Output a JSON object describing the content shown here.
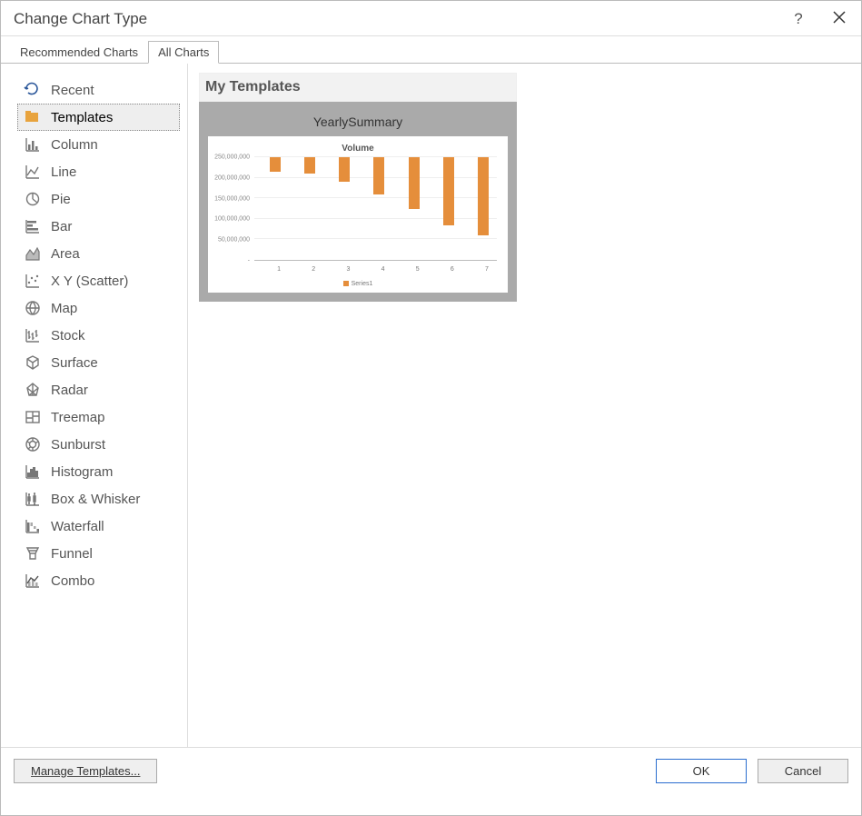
{
  "dialog": {
    "title": "Change Chart Type"
  },
  "tabs": {
    "recommended": "Recommended Charts",
    "all": "All Charts"
  },
  "sidebar": [
    {
      "label": "Recent",
      "icon": "recent"
    },
    {
      "label": "Templates",
      "icon": "templates"
    },
    {
      "label": "Column",
      "icon": "column"
    },
    {
      "label": "Line",
      "icon": "line"
    },
    {
      "label": "Pie",
      "icon": "pie"
    },
    {
      "label": "Bar",
      "icon": "bar"
    },
    {
      "label": "Area",
      "icon": "area"
    },
    {
      "label": "X Y (Scatter)",
      "icon": "scatter"
    },
    {
      "label": "Map",
      "icon": "map"
    },
    {
      "label": "Stock",
      "icon": "stock"
    },
    {
      "label": "Surface",
      "icon": "surface"
    },
    {
      "label": "Radar",
      "icon": "radar"
    },
    {
      "label": "Treemap",
      "icon": "treemap"
    },
    {
      "label": "Sunburst",
      "icon": "sunburst"
    },
    {
      "label": "Histogram",
      "icon": "histogram"
    },
    {
      "label": "Box & Whisker",
      "icon": "boxwhisker"
    },
    {
      "label": "Waterfall",
      "icon": "waterfall"
    },
    {
      "label": "Funnel",
      "icon": "funnel"
    },
    {
      "label": "Combo",
      "icon": "combo"
    }
  ],
  "activeSidebarIndex": 1,
  "section": {
    "title": "My Templates"
  },
  "template": {
    "name": "YearlySummary"
  },
  "chart_data": {
    "type": "bar",
    "title": "Volume",
    "categories": [
      "1",
      "2",
      "3",
      "4",
      "5",
      "6",
      "7"
    ],
    "values": [
      35000000,
      40000000,
      60000000,
      90000000,
      125000000,
      165000000,
      190000000
    ],
    "yticks": [
      "-",
      "50,000,000",
      "100,000,000",
      "150,000,000",
      "200,000,000",
      "250,000,000"
    ],
    "ylim": [
      0,
      250000000
    ],
    "legend": "Series1",
    "bar_color": "#e58e3b"
  },
  "footer": {
    "manage": "Manage Templates...",
    "ok": "OK",
    "cancel": "Cancel"
  }
}
